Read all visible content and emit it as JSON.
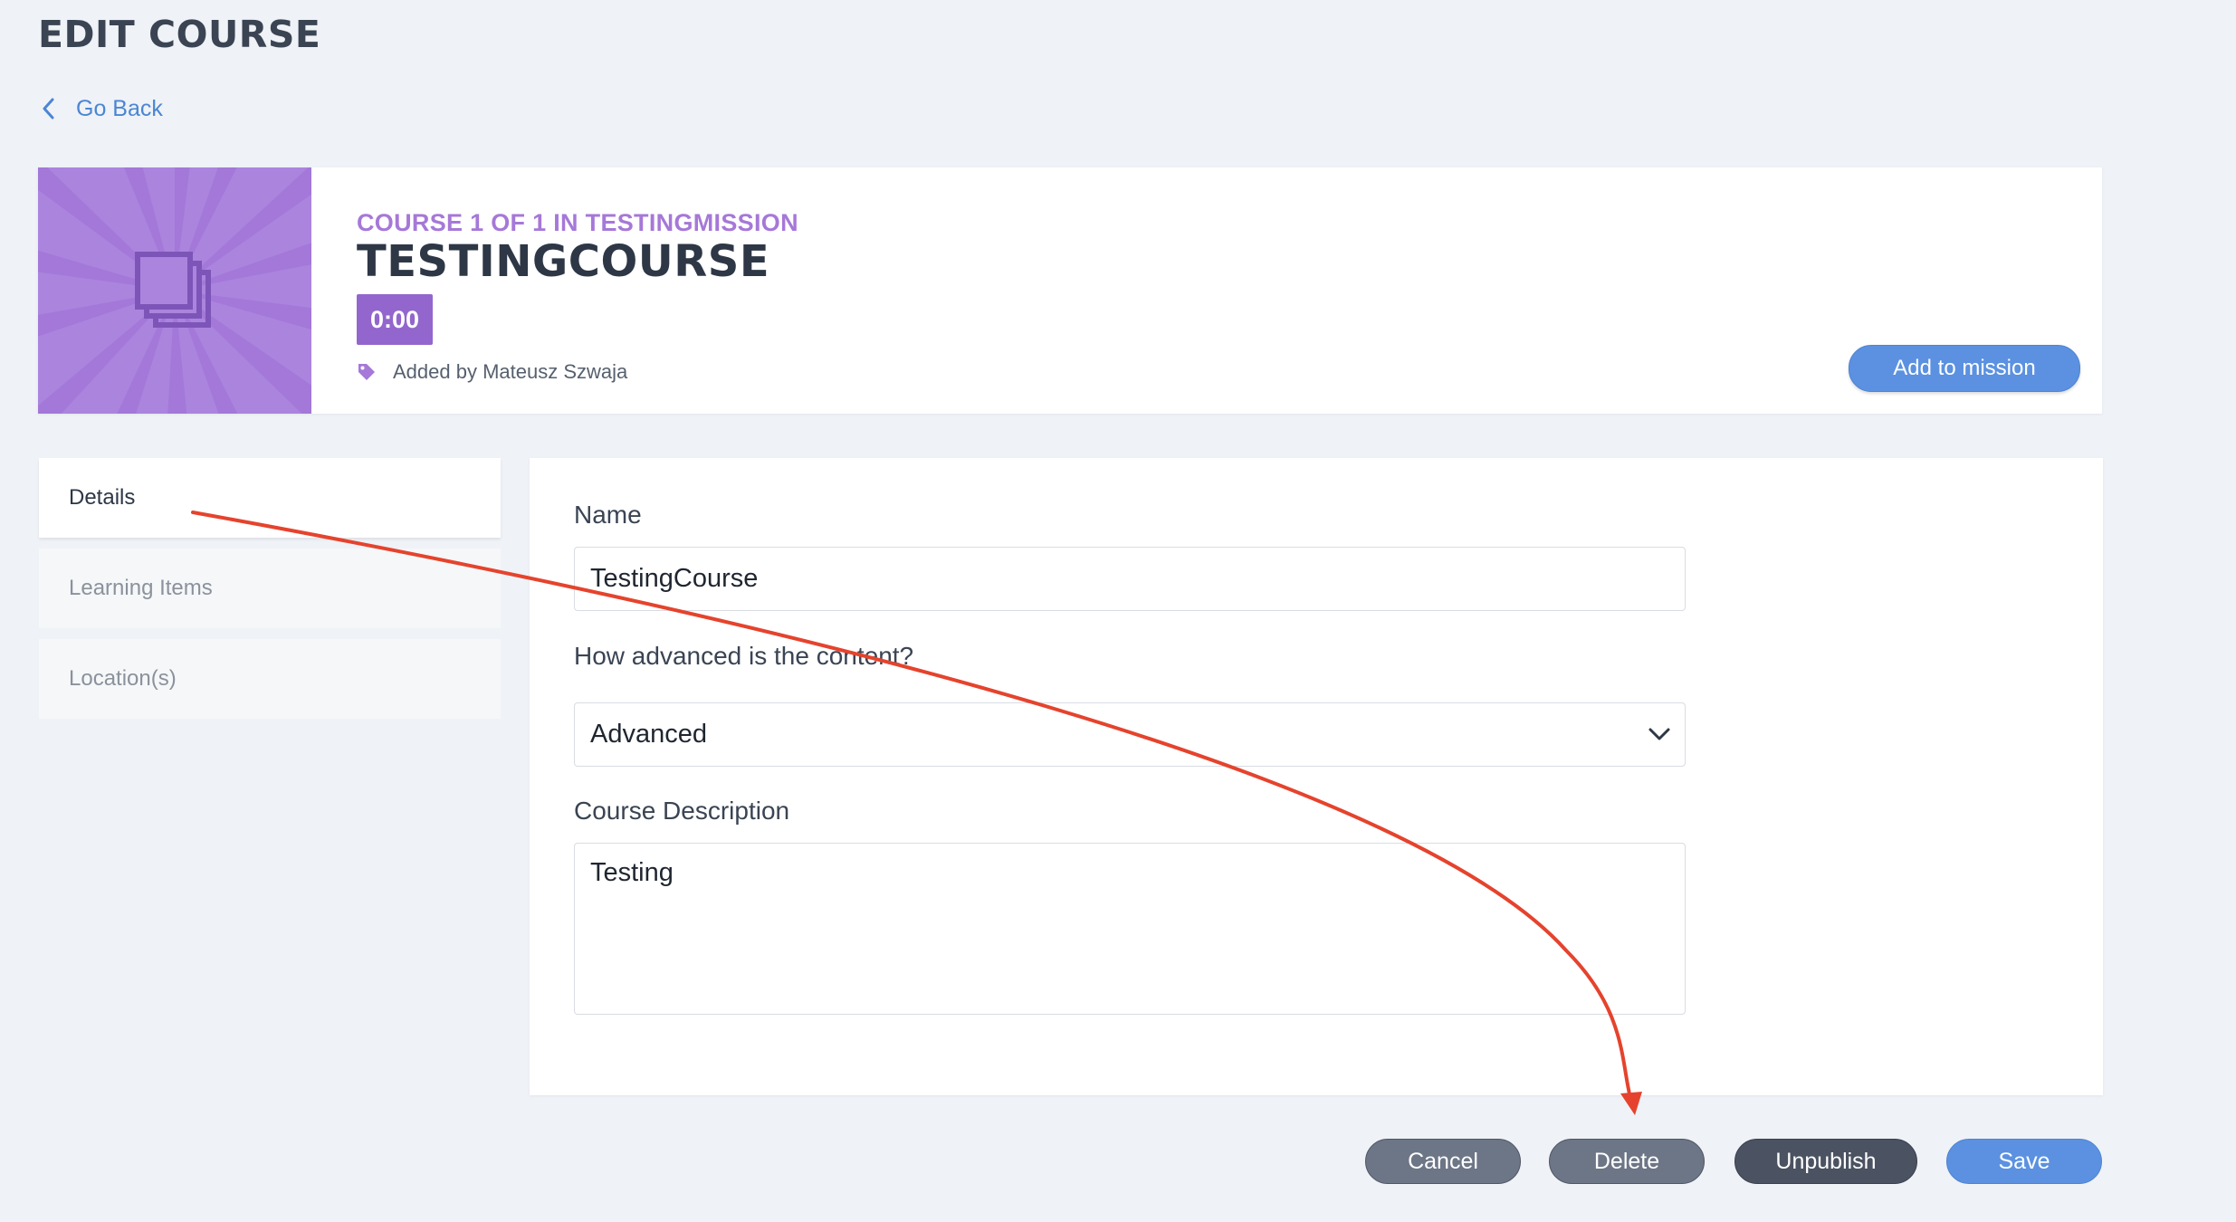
{
  "page": {
    "title": "EDIT COURSE",
    "back_label": "Go Back"
  },
  "course": {
    "meta": "COURSE 1 OF 1 IN TESTINGMISSION",
    "title": "TESTINGCOURSE",
    "duration": "0:00",
    "added_by": "Added by Mateusz Szwaja",
    "add_to_mission_label": "Add to mission"
  },
  "sidebar": {
    "items": [
      {
        "label": "Details",
        "active": true
      },
      {
        "label": "Learning Items",
        "active": false
      },
      {
        "label": "Location(s)",
        "active": false
      }
    ]
  },
  "form": {
    "name_label": "Name",
    "name_value": "TestingCourse",
    "level_label": "How advanced is the content?",
    "level_value": "Advanced",
    "description_label": "Course Description",
    "description_value": "Testing"
  },
  "actions": {
    "cancel": "Cancel",
    "delete": "Delete",
    "unpublish": "Unpublish",
    "save": "Save"
  },
  "colors": {
    "accent": "#5b91e0",
    "purple": "#a678d8",
    "annotation_arrow": "#e5432d"
  }
}
